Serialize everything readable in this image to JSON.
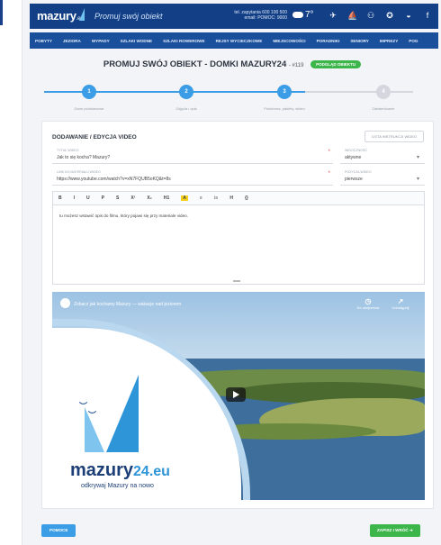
{
  "header": {
    "logo": "mazury",
    "logo_suffix": ".eu",
    "tagline": "Promuj swój obiekt",
    "phone": "tel. zapytania 600 100 500\nemail: POMOC: 9000",
    "temperature": "7°",
    "nav_items": [
      "POBYTY",
      "JEZIORA",
      "WYPADY",
      "SZLAKI WODNE",
      "SZLAKI ROWEROWE",
      "REJSY WYCIECZKOWE",
      "MIEJSCOWOŚCI",
      "PORADNIKI",
      "SENIORY",
      "IMPREZY",
      "POG"
    ]
  },
  "page": {
    "title": "PROMUJ SWÓJ OBIEKT - DOMKI MAZURY24",
    "id": "- #119",
    "badge": "PODGLĄD OBIEKTU"
  },
  "steps": [
    {
      "num": "1",
      "label": "Dane podstawowe"
    },
    {
      "num": "2",
      "label": "Zdjęcia i opis"
    },
    {
      "num": "3",
      "label": "Podstrona, pakiety, wideo"
    },
    {
      "num": "4",
      "label": "Zatwierdzanie"
    }
  ],
  "form": {
    "section_title": "DODAWANIE / EDYCJA VIDEO",
    "instructions_button": "LISTA INSTRUKCJI WIDEO",
    "title_label": "TYTUŁ WIDEO",
    "title_value": "Jak to się kocha? Mazury?",
    "url_label": "LINK DO MATERIAŁU WIDEO",
    "url_value": "https://www.youtube.com/watch?v=xN7FQUB5oKQ&t=8s",
    "visibility_label": "WIDOCZNOŚĆ",
    "visibility_value": "aktywne",
    "position_label": "POZYCJA WIDEO",
    "position_value": "pierwsze",
    "toolbar": [
      "B",
      "I",
      "U",
      "P",
      "S",
      "X²",
      "X₂",
      "H1",
      "A",
      "≡",
      "⁝≡",
      "H",
      "{}"
    ],
    "editor_text": "tu możesz wstawić opis do filmu, który pojawi się przy materiale video."
  },
  "video": {
    "title": "Zobacz jak kochamy Mazury — wakacje nad jeziorem",
    "ctrl1": "Do obejrzenia",
    "ctrl2": "Udostępnij",
    "brand": "mazury",
    "brand_suffix": "24.eu",
    "brand_sub": "odkrywaj Mazury na nowo"
  },
  "footer": {
    "help_button": "POMOCE",
    "save_button": "ZAPISZ I WRÓĆ"
  },
  "colors": {
    "brand_blue": "#123f86",
    "accent_blue": "#3b9de6",
    "green": "#3cb54a"
  }
}
